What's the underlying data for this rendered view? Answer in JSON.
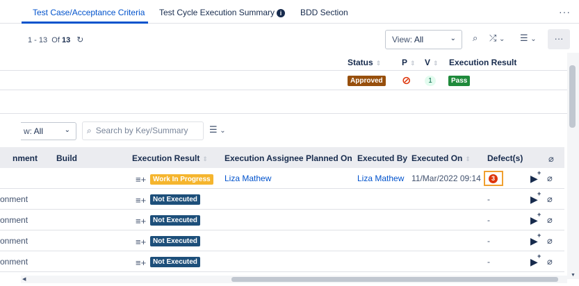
{
  "tabs": [
    {
      "label": "Test Case/Acceptance Criteria",
      "active": true
    },
    {
      "label": "Test Cycle Execution Summary",
      "active": false
    },
    {
      "label": "BDD Section",
      "active": false
    }
  ],
  "icons": {
    "info": "i",
    "more": "···",
    "refresh": "↻",
    "search": "⌕",
    "shuffle": "⤮",
    "filter": "☰",
    "caret": "⌄",
    "sort": "⇕",
    "blocked": "⊘",
    "exec": "≡+",
    "play": "▶",
    "plus": "+",
    "attach": "⌀"
  },
  "pager": {
    "from": "1",
    "to": "13",
    "of_label": "Of",
    "total": "13"
  },
  "view_select": {
    "prefix": "View:",
    "value": "All"
  },
  "upper_table": {
    "headers": {
      "status": "Status",
      "priority": "P",
      "version": "V",
      "result": "Execution Result"
    },
    "row": {
      "status": "Approved",
      "version": "1",
      "result": "Pass"
    }
  },
  "lower_toolbar": {
    "view_prefix": "w:",
    "view_value": "All",
    "search_placeholder": "Search by Key/Summary"
  },
  "lower_table": {
    "headers": {
      "environment": "nment",
      "build": "Build",
      "exec_result": "Execution Result",
      "assignee": "Execution Assignee",
      "planned_on": "Planned On",
      "executed_by": "Executed By",
      "executed_on": "Executed On",
      "defects": "Defect(s)"
    },
    "rows": [
      {
        "environment": "",
        "result": "Work In Progress",
        "assignee": "Liza Mathew",
        "executed_by": "Liza Mathew",
        "executed_on": "11/Mar/2022 09:14",
        "defects": "3"
      },
      {
        "environment": "onment",
        "result": "Not Executed",
        "assignee": "",
        "executed_by": "",
        "executed_on": "",
        "defects": "-"
      },
      {
        "environment": "onment",
        "result": "Not Executed",
        "assignee": "",
        "executed_by": "",
        "executed_on": "",
        "defects": "-"
      },
      {
        "environment": "onment",
        "result": "Not Executed",
        "assignee": "",
        "executed_by": "",
        "executed_on": "",
        "defects": "-"
      },
      {
        "environment": "onment",
        "result": "Not Executed",
        "assignee": "",
        "executed_by": "",
        "executed_on": "",
        "defects": "-"
      }
    ]
  },
  "colors": {
    "accent": "#0052cc",
    "approved": "#974f0c",
    "pass": "#1f8a3b",
    "wip": "#f5b52e",
    "not_executed": "#1d4f7a",
    "defect": "#de350b",
    "blocked": "#de350b",
    "version_bg": "#e3fcef",
    "version_fg": "#006644"
  }
}
